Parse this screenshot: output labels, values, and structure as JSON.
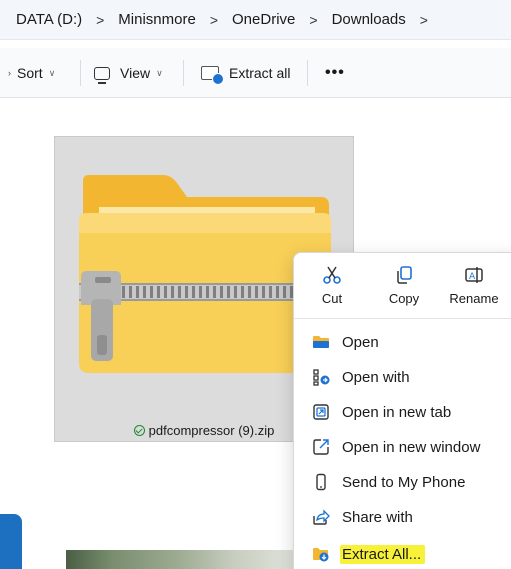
{
  "breadcrumb": {
    "items": [
      "DATA (D:)",
      "Minisnmore",
      "OneDrive",
      "Downloads"
    ],
    "separator": ">"
  },
  "commandbar": {
    "sort_label": "Sort",
    "view_label": "View",
    "extract_label": "Extract all",
    "more_label": "•••"
  },
  "file": {
    "name": "pdfcompressor (9).zip",
    "status": "synced"
  },
  "context_menu": {
    "quick_actions": [
      {
        "label": "Cut",
        "icon": "scissors-icon"
      },
      {
        "label": "Copy",
        "icon": "copy-icon"
      },
      {
        "label": "Rename",
        "icon": "rename-icon"
      }
    ],
    "items": [
      {
        "label": "Open",
        "icon": "folder-icon"
      },
      {
        "label": "Open with",
        "icon": "open-with-icon"
      },
      {
        "label": "Open in new tab",
        "icon": "new-tab-icon"
      },
      {
        "label": "Open in new window",
        "icon": "new-window-icon"
      },
      {
        "label": "Send to My Phone",
        "icon": "phone-icon"
      },
      {
        "label": "Share with",
        "icon": "share-icon"
      },
      {
        "label": "Extract All...",
        "icon": "extract-icon",
        "highlighted": true
      }
    ]
  },
  "colors": {
    "accent": "#1e73d2",
    "folder": "#f6c544",
    "highlight": "#f8f13a",
    "status_ok": "#1c8a2c"
  }
}
